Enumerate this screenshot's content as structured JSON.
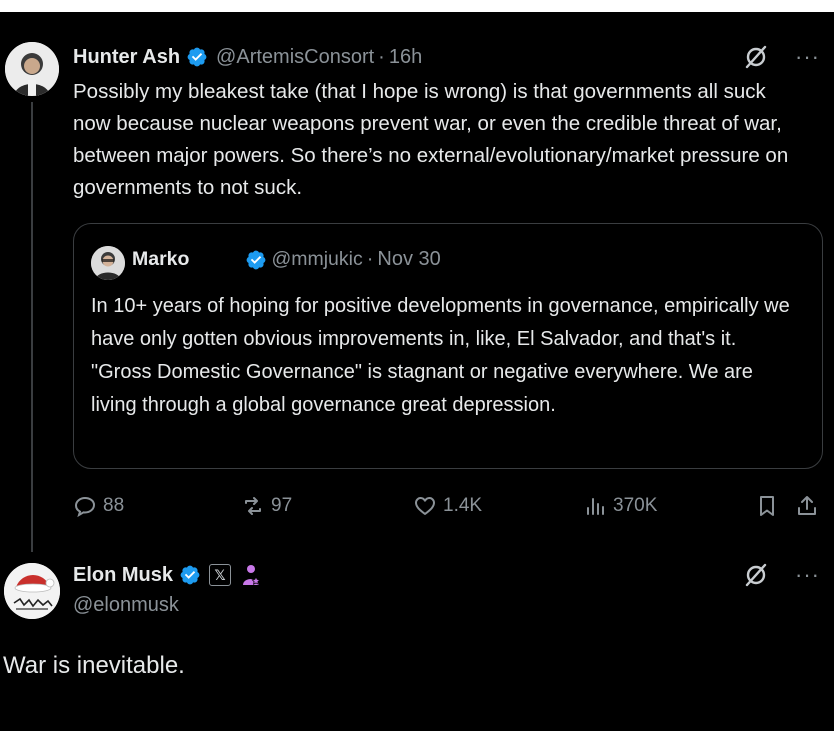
{
  "tweet": {
    "author_name": "Hunter Ash",
    "author_handle": "@ArtemisConsort",
    "time_sep": "·",
    "time": "16h",
    "text": "Possibly my bleakest take (that I hope is wrong) is that governments all suck now because nuclear weapons prevent war, or even the credible threat of war, between major powers. So there’s no external/evolutionary/market pressure on governments to not suck."
  },
  "quoted": {
    "author_name": "Marko",
    "author_handle": "@mmjukic",
    "time_sep": "·",
    "date": "Nov 30",
    "text": "In 10+ years of hoping for positive developments in governance, empirically we have only gotten obvious improvements in, like, El Salvador, and that's it. \"Gross Domestic Governance\" is stagnant or negative everywhere. We are living through a global governance great depression."
  },
  "stats": {
    "replies": "88",
    "reposts": "97",
    "likes": "1.4K",
    "views": "370K"
  },
  "reply": {
    "author_name": "Elon Musk",
    "author_handle": "@elonmusk",
    "text": "War is inevitable."
  },
  "ui": {
    "more_label": "···",
    "x_badge": "𝕏"
  },
  "icons": {
    "verified": "verified-badge-icon",
    "grok": "grok-icon",
    "more": "more-icon",
    "reply": "reply-icon",
    "repost": "repost-icon",
    "like": "heart-icon",
    "views": "views-icon",
    "bookmark": "bookmark-icon",
    "share": "share-icon"
  },
  "colors": {
    "background": "#000000",
    "text": "#e7e9ea",
    "muted": "#8b9298",
    "verified": "#1d9bf0",
    "subscriber": "#c878e8"
  }
}
